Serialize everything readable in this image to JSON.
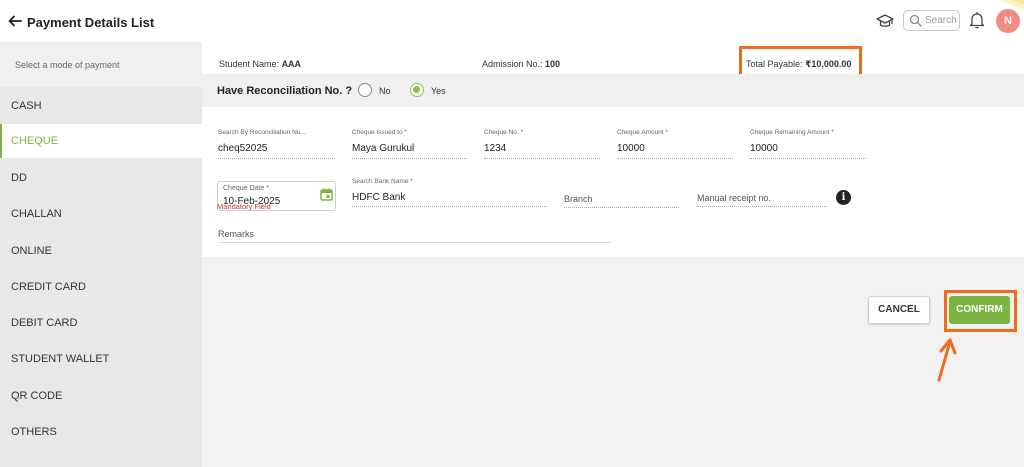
{
  "header": {
    "title": "Payment Details List",
    "search_placeholder": "Search",
    "avatar_initial": "N"
  },
  "sidebar": {
    "heading": "Select a mode of payment",
    "items": [
      {
        "label": "CASH",
        "active": false
      },
      {
        "label": "CHEQUE",
        "active": true
      },
      {
        "label": "DD",
        "active": false
      },
      {
        "label": "CHALLAN",
        "active": false
      },
      {
        "label": "ONLINE",
        "active": false
      },
      {
        "label": "CREDIT CARD",
        "active": false
      },
      {
        "label": "DEBIT CARD",
        "active": false
      },
      {
        "label": "STUDENT WALLET",
        "active": false
      },
      {
        "label": "QR CODE",
        "active": false
      },
      {
        "label": "OTHERS",
        "active": false
      }
    ]
  },
  "info": {
    "student_name_label": "Student Name:",
    "student_name": "AAA",
    "admission_label": "Admission No.:",
    "admission_no": "100",
    "total_label": "Total Payable:",
    "total": "₹10,000.00"
  },
  "reconciliation": {
    "question": "Have Reconciliation No. ?",
    "option_no": "No",
    "option_yes": "Yes",
    "selected": "Yes"
  },
  "form": {
    "search_recon": {
      "label": "Search By Reconciliation Nu...",
      "value": "cheq52025"
    },
    "cheque_issued_to": {
      "label": "Cheque issued to *",
      "value": "Maya Gurukul"
    },
    "cheque_no": {
      "label": "Cheque No. *",
      "value": "1234"
    },
    "cheque_amount": {
      "label": "Cheque Amount *",
      "value": "10000"
    },
    "cheque_remaining": {
      "label": "Cheque Remaining Amount *",
      "value": "10000"
    },
    "cheque_date": {
      "label": "Cheque Date *",
      "value": "10-Feb-2025",
      "error": "Mandatory Field"
    },
    "bank_name": {
      "label": "Search Bank Name *",
      "value": "HDFC Bank"
    },
    "branch": {
      "placeholder": "Branch"
    },
    "manual_receipt": {
      "placeholder": "Manual receipt no."
    },
    "remarks": {
      "placeholder": "Remarks"
    }
  },
  "actions": {
    "cancel": "CANCEL",
    "confirm": "CONFIRM"
  },
  "colors": {
    "accent_green": "#7cb342",
    "highlight_orange": "#f26b1d",
    "error_red": "#d32f2f"
  },
  "icons": [
    "back-arrow-icon",
    "graduation-cap-icon",
    "search-icon",
    "bell-icon",
    "calendar-icon",
    "info-icon"
  ]
}
